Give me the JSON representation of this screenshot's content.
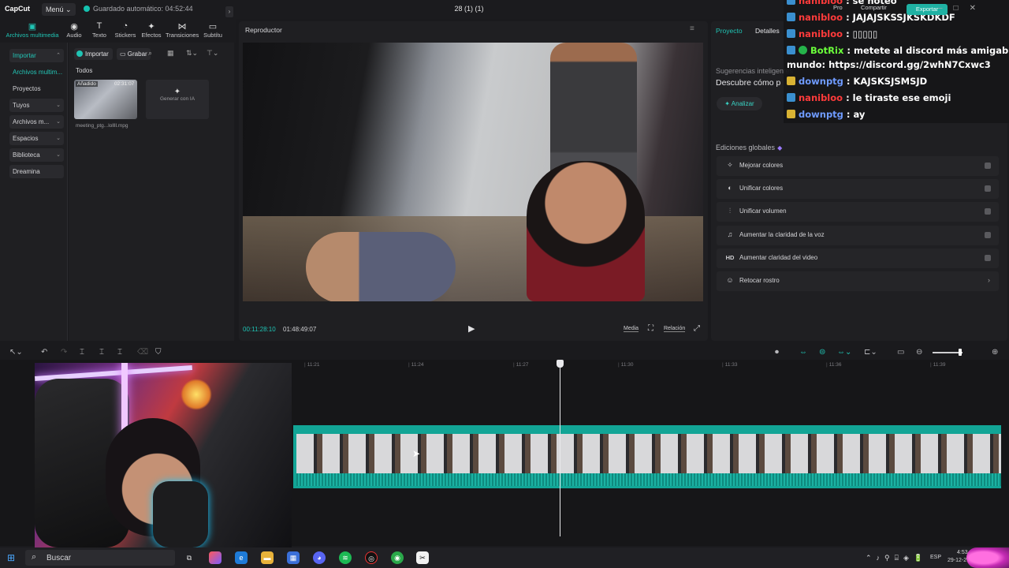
{
  "titlebar": {
    "logo": "CapCut",
    "menu": "Menú ⌄",
    "autosave": "Guardado automático: 04:52:44",
    "doc_title": "28 (1) (1)",
    "pro": "Pro",
    "share": "Compartir",
    "export": "Exportar"
  },
  "tools": [
    {
      "label": "Archivos multimedia",
      "icon": "media-icon"
    },
    {
      "label": "Audio",
      "icon": "audio-icon"
    },
    {
      "label": "Texto",
      "icon": "text-icon"
    },
    {
      "label": "Stickers",
      "icon": "sticker-icon"
    },
    {
      "label": "Efectos",
      "icon": "effects-icon"
    },
    {
      "label": "Transiciones",
      "icon": "transitions-icon"
    },
    {
      "label": "Subtítu",
      "icon": "subtitles-icon"
    }
  ],
  "sidebar": {
    "items": [
      {
        "label": "Importar"
      },
      {
        "label": "Archivos multim..."
      },
      {
        "label": "Proyectos secun..."
      },
      {
        "label": "Tuyos"
      },
      {
        "label": "Archivos m..."
      },
      {
        "label": "Espacios"
      },
      {
        "label": "Biblioteca"
      },
      {
        "label": "Dreamina"
      }
    ]
  },
  "media": {
    "import_btn": "Importar",
    "record_btn": "Grabar",
    "todos": "Todos",
    "clip_badge": "Añadido",
    "clip_duration": "02:31:07",
    "clip_name": "meeting_ptg...lollll.mpg",
    "gen_ai": "Generar con IA"
  },
  "player": {
    "title": "Reproductor",
    "timecode": "00:11:28:10",
    "duration": "01:48:49:07",
    "media_btn": "Media",
    "ratio_btn": "Relación"
  },
  "right_panel": {
    "tab_project": "Proyecto",
    "tab_details": "Detalles",
    "suggestions_title": "Sugerencias inteligentes",
    "suggestions_desc": "Descubre cómo p",
    "analyze_btn": "Analizar",
    "global_title": "Ediciones globales",
    "edits": [
      {
        "label": "Mejorar colores",
        "icon": "magic-wand-icon",
        "glyph": "✧"
      },
      {
        "label": "Unificar colores",
        "icon": "palette-icon",
        "glyph": "◐"
      },
      {
        "label": "Unificar volumen",
        "icon": "volume-bars-icon",
        "glyph": "⫶"
      },
      {
        "label": "Aumentar la claridad de la voz",
        "icon": "voice-wave-icon",
        "glyph": "♫"
      },
      {
        "label": "Aumentar claridad del video",
        "icon": "hd-icon",
        "glyph": "HD"
      },
      {
        "label": "Retocar rostro",
        "icon": "face-icon",
        "glyph": "☺"
      }
    ]
  },
  "chat": {
    "lines": [
      {
        "user": "nanibloo",
        "text": " : se noteo",
        "badge": "b",
        "color": "red"
      },
      {
        "user": "nanibloo",
        "text": " : JAJAJSKSSJKSKDKDF",
        "badge": "b",
        "color": "red"
      },
      {
        "user": "nanibloo",
        "text": " : ▯▯▯▯▯",
        "badge": "b",
        "color": "red"
      },
      {
        "user": "BotRix",
        "text": " : metete al discord más amigable del",
        "badge": "g",
        "color": "green"
      },
      {
        "user": "",
        "text": "mundo: https://discord.gg/2whN7Cxwc3",
        "badge": "",
        "color": ""
      },
      {
        "user": "downptg",
        "text": " : KAJSKSJSMSJD",
        "badge": "y",
        "color": "blue"
      },
      {
        "user": "nanibloo",
        "text": " : le tiraste ese emoji",
        "badge": "b",
        "color": "red"
      },
      {
        "user": "downptg",
        "text": " : ay",
        "badge": "y",
        "color": "blue"
      }
    ]
  },
  "timeline": {
    "ticks": [
      "11:21",
      "11:24",
      "11:27",
      "11:30",
      "11:33",
      "11:36",
      "11:39"
    ]
  },
  "taskbar": {
    "search": "Buscar",
    "lang": "ESP",
    "time": "4:53",
    "date": "29-12-2"
  },
  "colors": {
    "accent": "#20c4b4",
    "track": "#12a596"
  }
}
